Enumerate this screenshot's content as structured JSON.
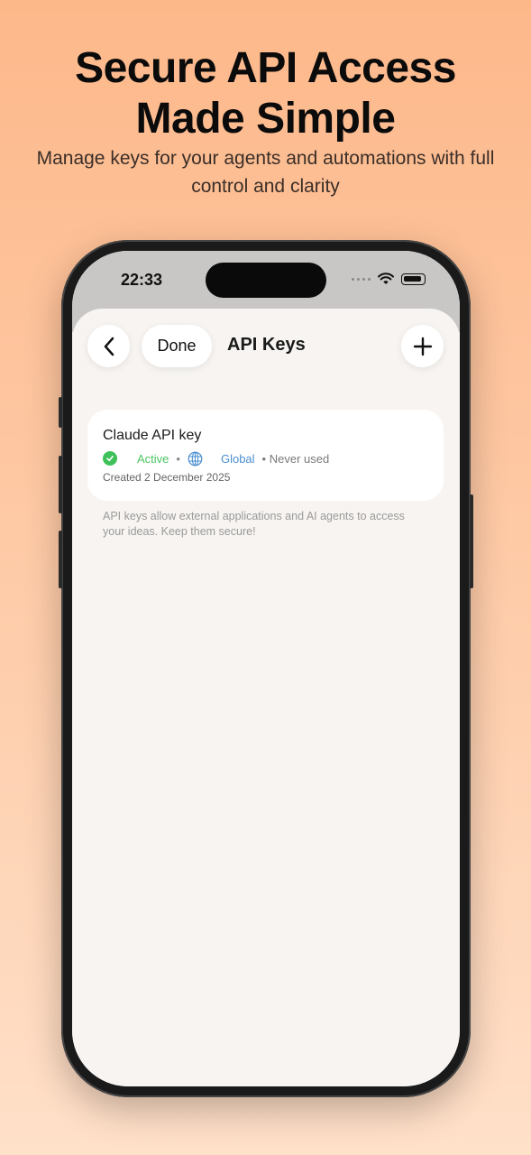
{
  "promo": {
    "headline_line1": "Secure API Access",
    "headline_line2": "Made Simple",
    "subheadline": "Manage keys for your agents and automations with full control and clarity"
  },
  "status_bar": {
    "time": "22:33"
  },
  "nav": {
    "back_icon": "chevron-left-icon",
    "done_label": "Done",
    "title": "API Keys",
    "add_icon": "plus-icon"
  },
  "api_keys": [
    {
      "name": "Claude API key",
      "status": "Active",
      "scope": "Global",
      "usage": "Never used",
      "created": "Created 2 December 2025"
    }
  ],
  "helper_text": "API keys allow external applications and AI agents to access your ideas. Keep them secure!",
  "colors": {
    "active": "#4cc463",
    "global": "#4b8fd0",
    "background_top": "#fdb88a",
    "background_bottom": "#ffe0c9"
  }
}
